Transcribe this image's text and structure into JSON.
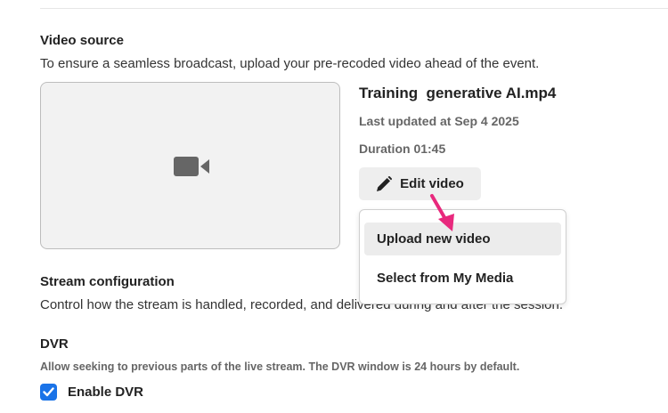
{
  "video_source": {
    "title": "Video source",
    "description": "To ensure a seamless broadcast, upload your pre-recoded video ahead of the event.",
    "file_name": "Training  generative AI.mp4",
    "last_updated": "Last updated at Sep 4 2025",
    "duration": "Duration 01:45",
    "edit_label": "Edit video",
    "thumbnail_icon": "video-camera-icon"
  },
  "edit_menu": {
    "items": [
      {
        "label": "Upload new video",
        "highlighted": true
      },
      {
        "label": "Select from My Media",
        "highlighted": false
      }
    ]
  },
  "stream_configuration": {
    "title": "Stream configuration",
    "description": "Control how the stream is handled, recorded, and delivered during and after the session."
  },
  "dvr": {
    "title": "DVR",
    "description": "Allow seeking to previous parts of the live stream. The DVR window is 24 hours by default.",
    "checkbox_label": "Enable DVR",
    "checked": true
  },
  "colors": {
    "accent": "#1a73e8",
    "annotation_arrow": "#e8297d"
  }
}
